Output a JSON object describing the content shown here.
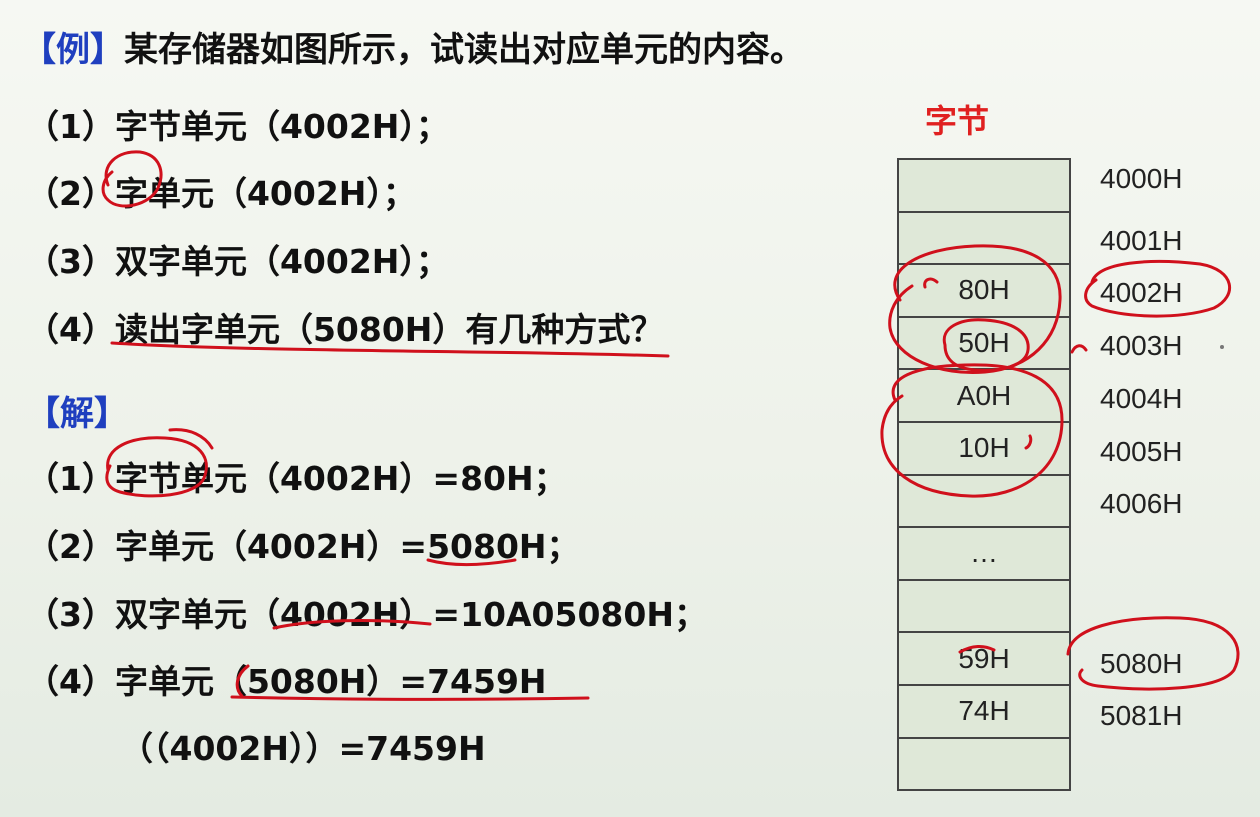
{
  "question": {
    "tag": "【例】",
    "text": "某存储器如图所示，试读出对应单元的内容。",
    "items": [
      "（1）字节单元（4002H）；",
      "（2）字单元（4002H）；",
      "（3）双字单元（4002H）；",
      "（4）读出字单元（5080H）有几种方式？"
    ]
  },
  "solution": {
    "tag": "【解】",
    "items": [
      "（1）字节单元（4002H）=80H；",
      "（2）字单元（4002H）=5080H；",
      "（3）双字单元（4002H）=10A05080H；",
      "（4）字单元（5080H）=7459H",
      "（（4002H））=7459H"
    ]
  },
  "memory": {
    "header": "字节",
    "cells": [
      "",
      "",
      "80H",
      "50H",
      "A0H",
      "10H",
      "",
      "…",
      "",
      "59H",
      "74H",
      ""
    ],
    "addresses": [
      "4000H",
      "4001H",
      "4002H",
      "4003H",
      "4004H",
      "4005H",
      "4006H",
      "5080H",
      "5081H"
    ]
  },
  "colors": {
    "bracket_blue": "#1f3fbf",
    "header_red": "#e02020",
    "ink_red": "#d0101c",
    "cell_fill": "#dfe8d8"
  }
}
